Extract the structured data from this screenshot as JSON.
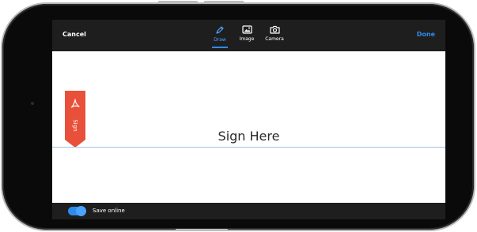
{
  "header": {
    "cancel_label": "Cancel",
    "done_label": "Done",
    "tabs": [
      {
        "label": "Draw",
        "icon": "pen-icon",
        "active": true
      },
      {
        "label": "Image",
        "icon": "image-icon",
        "active": false
      },
      {
        "label": "Camera",
        "icon": "camera-icon",
        "active": false
      }
    ]
  },
  "canvas": {
    "tag_label": "Sign",
    "tag_icon": "acrobat-logo-icon",
    "prompt": "Sign Here"
  },
  "footer": {
    "save_online_label": "Save online",
    "save_online_enabled": true
  },
  "colors": {
    "accent": "#2d8ceb",
    "toolbar": "#1e1e1e",
    "tag": "#e8503a",
    "sign_line": "#9cc3e6"
  }
}
